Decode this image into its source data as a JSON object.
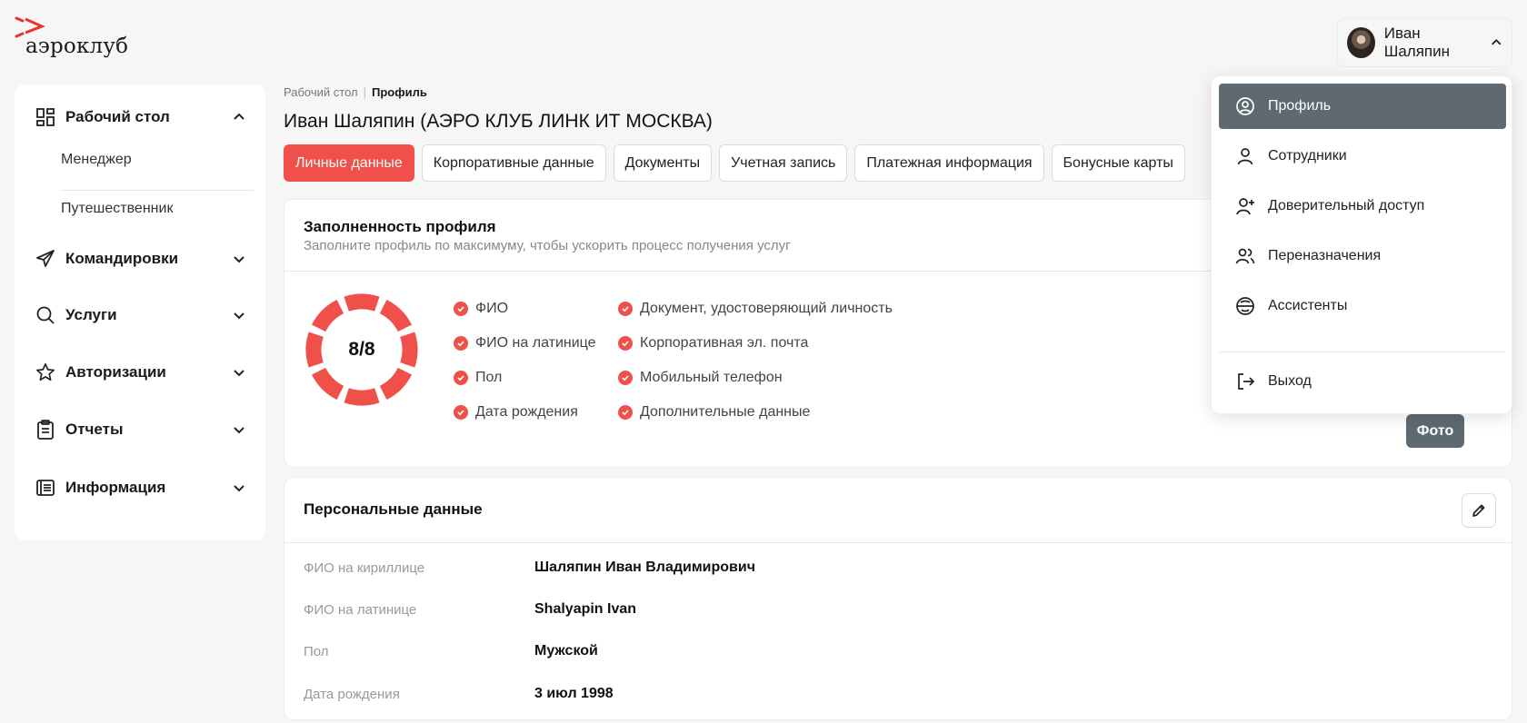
{
  "logo": {
    "text": "аэроклуб"
  },
  "user": {
    "name": "Иван Шаляпин"
  },
  "sidebar": {
    "items": [
      {
        "label": "Рабочий стол",
        "icon": "dashboard-icon",
        "expanded": true,
        "children": [
          "Менеджер",
          "Путешественник"
        ]
      },
      {
        "label": "Командировки",
        "icon": "send-icon"
      },
      {
        "label": "Услуги",
        "icon": "search-icon"
      },
      {
        "label": "Авторизации",
        "icon": "star-icon"
      },
      {
        "label": "Отчеты",
        "icon": "clipboard-icon"
      },
      {
        "label": "Информация",
        "icon": "info-list-icon"
      }
    ]
  },
  "breadcrumb": {
    "parent": "Рабочий стол",
    "separator": "|",
    "current": "Профиль"
  },
  "page": {
    "title": "Иван Шаляпин (АЭРО КЛУБ ЛИНК ИТ МОСКВА)"
  },
  "tabs": [
    {
      "label": "Личные данные",
      "active": true
    },
    {
      "label": "Корпоративные данные"
    },
    {
      "label": "Документы"
    },
    {
      "label": "Учетная запись"
    },
    {
      "label": "Платежная информация"
    },
    {
      "label": "Бонусные карты"
    }
  ],
  "completeness": {
    "title": "Заполненность профиля",
    "subtitle": "Заполните профиль по максимуму, чтобы ускорить процесс получения услуг",
    "score_text": "8/8",
    "filled": 8,
    "total": 8,
    "accent": "#f0504a",
    "checks_left": [
      "ФИО",
      "ФИО на латинице",
      "Пол",
      "Дата рождения"
    ],
    "checks_right": [
      "Документ, удостоверяющий личность",
      "Корпоративная эл. почта",
      "Мобильный телефон",
      "Дополнительные данные"
    ],
    "photo_button": "Фото"
  },
  "personal": {
    "title": "Персональные данные",
    "rows": [
      {
        "label": "ФИО на кириллице",
        "value": "Шаляпин Иван Владимирович"
      },
      {
        "label": "ФИО на латинице",
        "value": "Shalyapin Ivan"
      },
      {
        "label": "Пол",
        "value": "Мужской"
      },
      {
        "label": "Дата рождения",
        "value": "3 июл 1998"
      }
    ]
  },
  "user_menu": {
    "items": [
      {
        "label": "Профиль",
        "icon": "user-circle-icon",
        "active": true
      },
      {
        "label": "Сотрудники",
        "icon": "user-icon"
      },
      {
        "label": "Доверительный доступ",
        "icon": "user-plus-icon"
      },
      {
        "label": "Переназначения",
        "icon": "users-icon"
      },
      {
        "label": "Ассистенты",
        "icon": "assistant-icon"
      }
    ],
    "logout": {
      "label": "Выход",
      "icon": "logout-icon"
    }
  },
  "colors": {
    "accent": "#f0504a",
    "menu_active": "#5e6a70",
    "background": "#f6f6f6"
  }
}
